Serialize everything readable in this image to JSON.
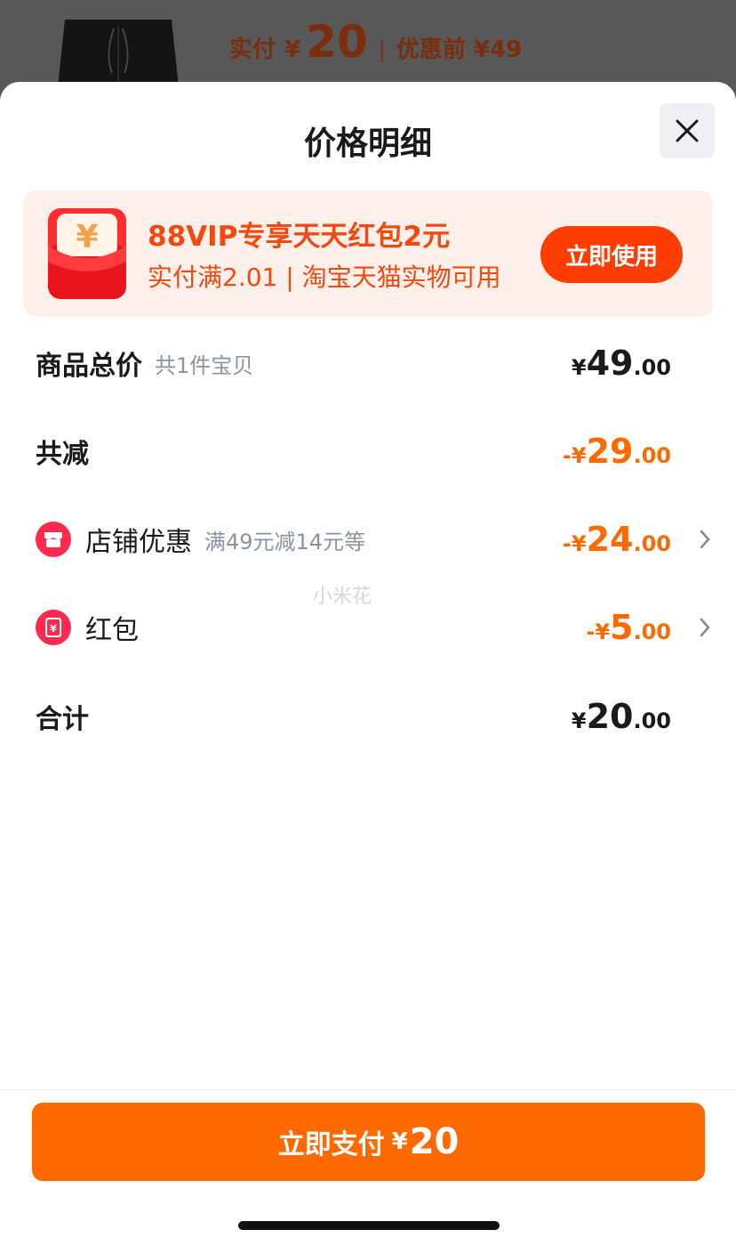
{
  "header_preview": {
    "paid_label": "实付",
    "currency": "¥",
    "paid_amount": "20",
    "separator": "|",
    "before_discount": "优惠前 ¥49"
  },
  "sheet": {
    "title": "价格明细",
    "close_icon": "close-icon"
  },
  "promo": {
    "title": "88VIP专享天天红包2元",
    "subtitle": "实付满2.01 | 淘宝天猫实物可用",
    "button_label": "立即使用",
    "icon": "red-envelope-icon"
  },
  "rows": {
    "total": {
      "label": "商品总价",
      "sub": "共1件宝贝",
      "yen": "¥",
      "int": "49",
      "dec": ".00"
    },
    "discount": {
      "label": "共减",
      "yen": "-¥",
      "int": "29",
      "dec": ".00"
    },
    "store": {
      "label": "店铺优惠",
      "sub": "满49元减14元等",
      "yen": "-¥",
      "int": "24",
      "dec": ".00",
      "icon": "store-icon"
    },
    "redpacket": {
      "label": "红包",
      "yen": "-¥",
      "int": "5",
      "dec": ".00",
      "icon": "red-packet-icon"
    },
    "sum": {
      "label": "合计",
      "yen": "¥",
      "int": "20",
      "dec": ".00"
    }
  },
  "watermark": "小米花",
  "pay_button": {
    "label": "立即支付",
    "yen": "¥",
    "amount": "20"
  },
  "colors": {
    "accent": "#ff6a00",
    "promo_red": "#ff3d00",
    "promo_bg": "#fdf0ea"
  }
}
